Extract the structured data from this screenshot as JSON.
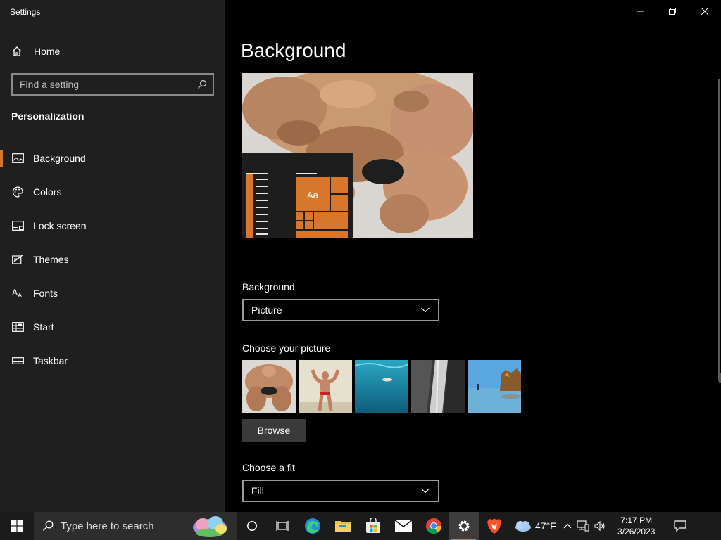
{
  "window": {
    "title": "Settings"
  },
  "sidebar": {
    "home_label": "Home",
    "search_placeholder": "Find a setting",
    "section_title": "Personalization",
    "items": [
      {
        "label": "Background",
        "icon": "picture-icon",
        "active": true
      },
      {
        "label": "Colors",
        "icon": "palette-icon",
        "active": false
      },
      {
        "label": "Lock screen",
        "icon": "lock-screen-icon",
        "active": false
      },
      {
        "label": "Themes",
        "icon": "themes-icon",
        "active": false
      },
      {
        "label": "Fonts",
        "icon": "fonts-icon",
        "active": false
      },
      {
        "label": "Start",
        "icon": "start-icon",
        "active": false
      },
      {
        "label": "Taskbar",
        "icon": "taskbar-icon",
        "active": false
      }
    ]
  },
  "main": {
    "title": "Background",
    "preview": {
      "sample_text": "Aa"
    },
    "background_label": "Background",
    "background_value": "Picture",
    "choose_picture_label": "Choose your picture",
    "pictures": [
      "bodybuilder-closeup",
      "bodybuilder-pose",
      "underwater-swimmer",
      "waterfall-rocks",
      "beach-rocks"
    ],
    "browse_label": "Browse",
    "fit_label": "Choose a fit",
    "fit_value": "Fill"
  },
  "taskbar": {
    "search_placeholder": "Type here to search",
    "weather_temp": "47°F",
    "time": "7:17 PM",
    "date": "3/26/2023"
  },
  "colors": {
    "accent": "#d8772b",
    "sidebar_bg": "#1f1f1f",
    "main_bg": "#000000"
  }
}
